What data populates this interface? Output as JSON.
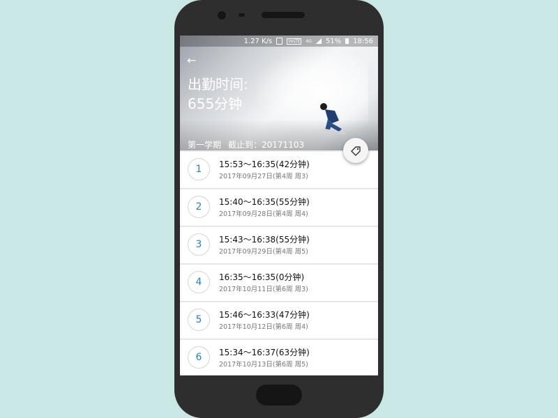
{
  "status_bar": {
    "speed": "1.27 K/s",
    "network": "4G",
    "lte": "VoLTE",
    "battery": "51%",
    "time": "18:56"
  },
  "header": {
    "back_icon": "arrow-left-icon",
    "title": "出勤时间:",
    "value": "655分钟",
    "term": "第一学期",
    "deadline": "截止到：20171103"
  },
  "fab_icon": "tag-icon",
  "colors": {
    "accent": "#1e82d2",
    "background": "#c9e7e5",
    "phone": "#2e2e2e"
  },
  "records": [
    {
      "index": "1",
      "time": "15:53～16:35(42分钟)",
      "date": "2017年09月27日(第4周 周3)"
    },
    {
      "index": "2",
      "time": "15:40～16:35(55分钟)",
      "date": "2017年09月28日(第4周 周4)"
    },
    {
      "index": "3",
      "time": "15:43～16:38(55分钟)",
      "date": "2017年09月29日(第4周 周5)"
    },
    {
      "index": "4",
      "time": "16:35～16:35(0分钟)",
      "date": "2017年10月11日(第6周 周3)"
    },
    {
      "index": "5",
      "time": "15:46～16:33(47分钟)",
      "date": "2017年10月12日(第6周 周4)"
    },
    {
      "index": "6",
      "time": "15:34～16:37(63分钟)",
      "date": "2017年10月13日(第6周 周5)"
    }
  ]
}
